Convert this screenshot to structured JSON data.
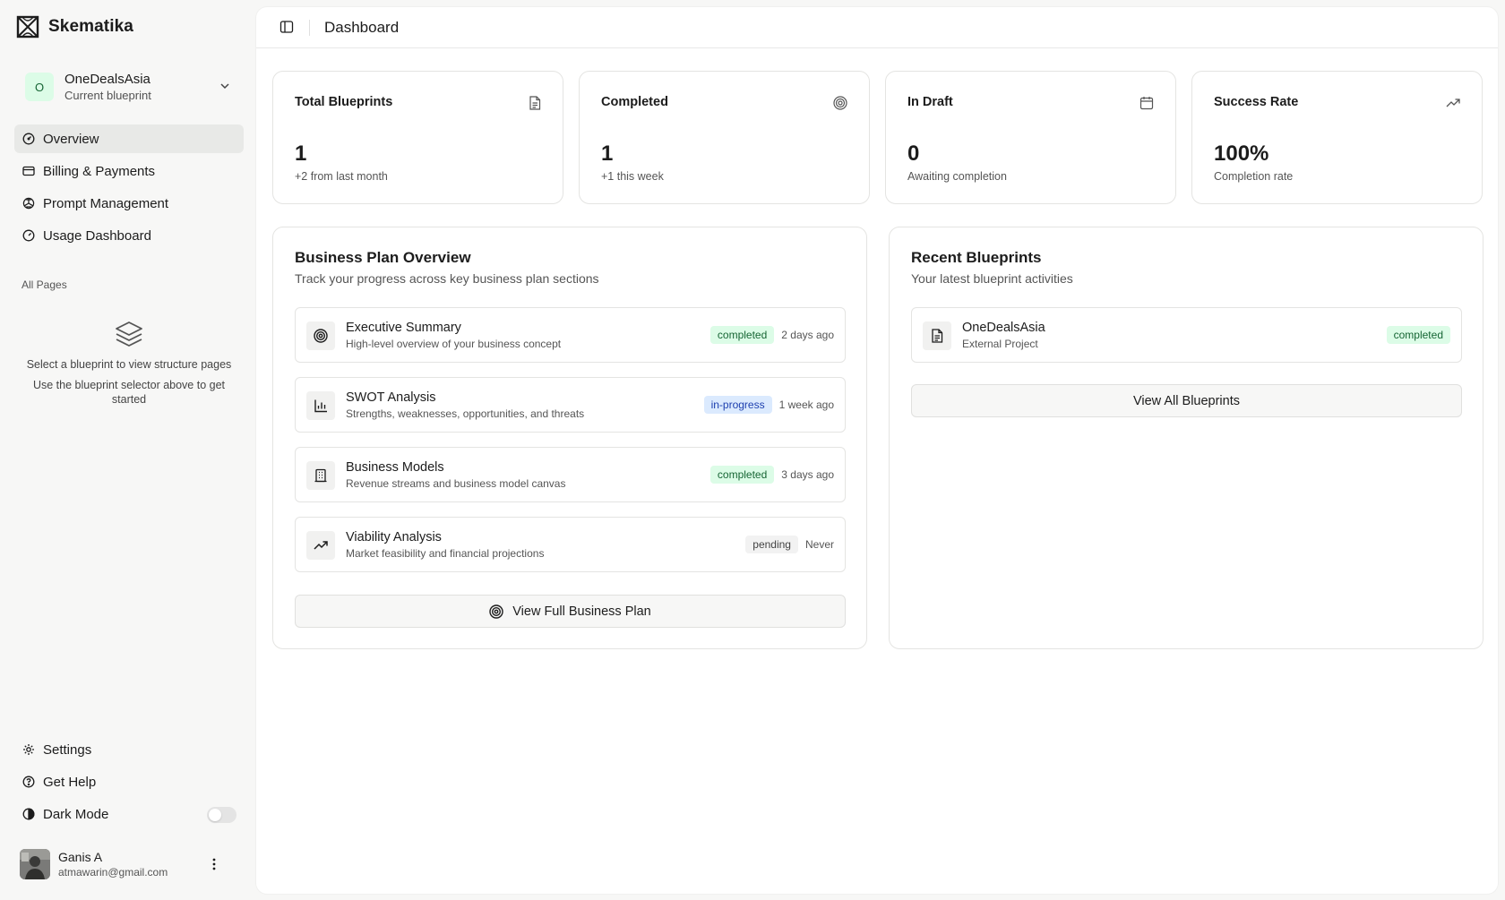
{
  "app": {
    "name": "Skematika"
  },
  "blueprint_selector": {
    "initial": "O",
    "name": "OneDealsAsia",
    "subtitle": "Current blueprint"
  },
  "nav": {
    "items": [
      {
        "label": "Overview",
        "icon": "gauge-icon",
        "active": true
      },
      {
        "label": "Billing & Payments",
        "icon": "credit-card-icon"
      },
      {
        "label": "Prompt Management",
        "icon": "openai-icon"
      },
      {
        "label": "Usage Dashboard",
        "icon": "gauge-icon"
      }
    ],
    "all_pages_label": "All Pages",
    "empty_state": {
      "line1": "Select a blueprint to view structure pages",
      "line2": "Use the blueprint selector above to get started"
    },
    "bottom": [
      {
        "label": "Settings",
        "icon": "gear-icon"
      },
      {
        "label": "Get Help",
        "icon": "help-circle-icon"
      },
      {
        "label": "Dark Mode",
        "icon": "contrast-icon",
        "toggle": false
      }
    ]
  },
  "user": {
    "name": "Ganis A",
    "email": "atmawarin@gmail.com"
  },
  "header": {
    "title": "Dashboard"
  },
  "stats": [
    {
      "title": "Total Blueprints",
      "value": "1",
      "sub": "+2 from last month",
      "icon": "file-text-icon"
    },
    {
      "title": "Completed",
      "value": "1",
      "sub": "+1 this week",
      "icon": "target-icon"
    },
    {
      "title": "In Draft",
      "value": "0",
      "sub": "Awaiting completion",
      "icon": "calendar-icon"
    },
    {
      "title": "Success Rate",
      "value": "100%",
      "sub": "Completion rate",
      "icon": "trending-up-icon"
    }
  ],
  "business_plan": {
    "title": "Business Plan Overview",
    "subtitle": "Track your progress across key business plan sections",
    "items": [
      {
        "name": "Executive Summary",
        "desc": "High-level overview of your business concept",
        "status": "completed",
        "time": "2 days ago",
        "icon": "target-icon"
      },
      {
        "name": "SWOT Analysis",
        "desc": "Strengths, weaknesses, opportunities, and threats",
        "status": "in-progress",
        "time": "1 week ago",
        "icon": "bar-chart-icon"
      },
      {
        "name": "Business Models",
        "desc": "Revenue streams and business model canvas",
        "status": "completed",
        "time": "3 days ago",
        "icon": "building-icon"
      },
      {
        "name": "Viability Analysis",
        "desc": "Market feasibility and financial projections",
        "status": "pending",
        "time": "Never",
        "icon": "trending-up-icon"
      }
    ],
    "button": "View Full Business Plan"
  },
  "recent": {
    "title": "Recent Blueprints",
    "subtitle": "Your latest blueprint activities",
    "items": [
      {
        "name": "OneDealsAsia",
        "desc": "External Project",
        "status": "completed",
        "icon": "file-text-icon"
      }
    ],
    "button": "View All Blueprints"
  },
  "colors": {
    "completed_bg": "#dcfce7",
    "completed_fg": "#166534",
    "progress_bg": "#dbeafe",
    "progress_fg": "#1e40af",
    "pending_bg": "#f2f2f2",
    "pending_fg": "#444444",
    "active_nav": "#e8e9e7"
  }
}
